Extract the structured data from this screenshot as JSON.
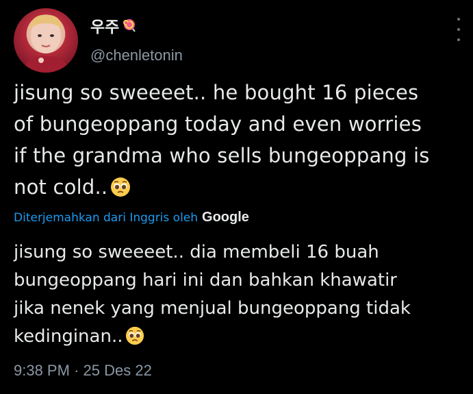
{
  "user": {
    "display_name": "우주",
    "display_emoji": "lollipop-icon",
    "handle": "@chenletonin"
  },
  "tweet": {
    "lines": [
      "jisung so sweeeet.. he bought 16 pieces",
      "of bungeoppang today and even worries",
      "if the grandma who sells bungeoppang is",
      "not cold.."
    ],
    "end_emoji": "pleading-face-icon"
  },
  "translation": {
    "label": "Diterjemahkan dari Inggris oleh",
    "provider": "Google",
    "lines": [
      "jisung so sweeeet.. dia membeli 16 buah",
      "bungeoppang hari ini dan bahkan khawatir",
      "jika nenek yang menjual bungeoppang tidak",
      "kedinginan.."
    ]
  },
  "meta": {
    "time": "9:38 PM",
    "separator": "·",
    "date": "25 Des 22"
  },
  "colors": {
    "background": "#000000",
    "text": "#e7e9ea",
    "secondary": "#8b98a5",
    "link": "#1d9bf0"
  }
}
